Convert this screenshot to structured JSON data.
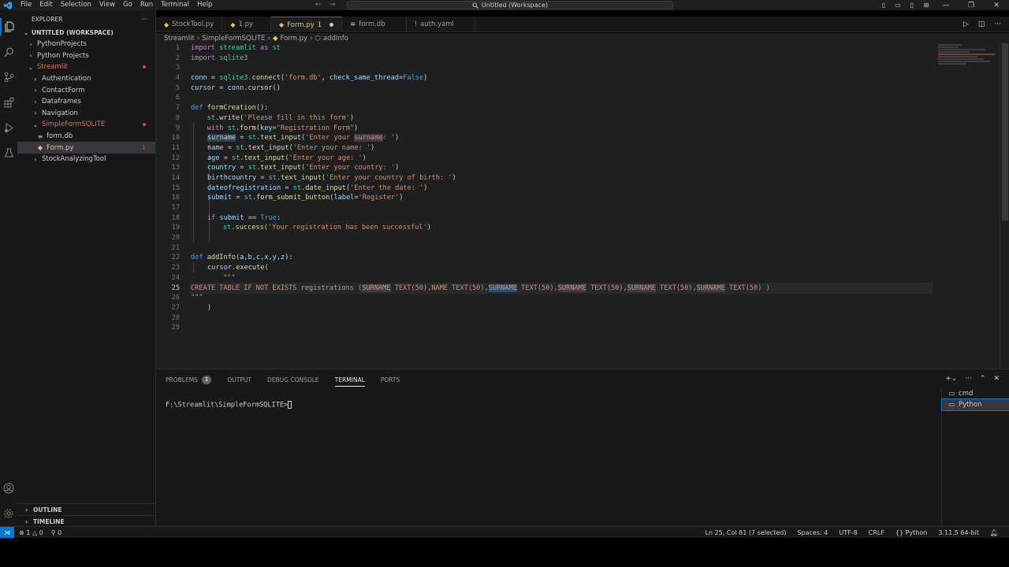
{
  "titlebar": {
    "menu": [
      "File",
      "Edit",
      "Selection",
      "View",
      "Go",
      "Run",
      "Terminal",
      "Help"
    ],
    "search_text": "Untitled (Workspace)"
  },
  "sidebar": {
    "header": "EXPLORER",
    "workspace": "UNTITLED (WORKSPACE)",
    "items": [
      {
        "label": "PythonProjects",
        "indent": 1,
        "chev": "›"
      },
      {
        "label": "Python Projects",
        "indent": 1,
        "chev": "›"
      },
      {
        "label": "Streamlit",
        "indent": 1,
        "chev": "⌄"
      },
      {
        "label": "Authentication",
        "indent": 2,
        "chev": "›"
      },
      {
        "label": "ContactForm",
        "indent": 2,
        "chev": "›"
      },
      {
        "label": "Dataframes",
        "indent": 2,
        "chev": "›"
      },
      {
        "label": "Navigation",
        "indent": 2,
        "chev": "›"
      },
      {
        "label": "SimpleFormSQLITE",
        "indent": 2,
        "chev": "⌄"
      },
      {
        "label": "form.db",
        "indent": 3,
        "chev": "≡"
      },
      {
        "label": "Form.py",
        "indent": 3,
        "chev": "◆",
        "badge": "1"
      },
      {
        "label": "StockAnalyzingTool",
        "indent": 2,
        "chev": "›"
      }
    ],
    "outline": "OUTLINE",
    "timeline": "TIMELINE"
  },
  "tabs": [
    {
      "label": "StockTool.py"
    },
    {
      "label": "1.py"
    },
    {
      "label": "Form.py",
      "count": "1"
    },
    {
      "label": "form.db"
    },
    {
      "label": "auth.yaml"
    }
  ],
  "breadcrumb": [
    "Streamlit",
    "SimpleFormSQLITE",
    "Form.py",
    "addInfo"
  ],
  "code": {
    "current_line": 25,
    "line_numbers": [
      "1",
      "2",
      "3",
      "4",
      "5",
      "6",
      "7",
      "8",
      "9",
      "10",
      "11",
      "12",
      "13",
      "14",
      "15",
      "16",
      "17",
      "18",
      "19",
      "20",
      "21",
      "22",
      "23",
      "24",
      "25",
      "26",
      "27",
      "28",
      "29"
    ],
    "lines": {
      "l1a": "import",
      "l1b": " streamlit ",
      "l1c": "as",
      "l1d": " st",
      "l2a": "import",
      "l2b": " sqlite3",
      "l4a": "conn",
      "l4b": " = ",
      "l4c": "sqlite3",
      "l4d": ".",
      "l4e": "connect",
      "l4f": "(",
      "l4g": "'form.db'",
      "l4h": ", ",
      "l4i": "check_same_thread",
      "l4j": "=",
      "l4k": "False",
      "l4l": ")",
      "l5a": "cursor",
      "l5b": " = ",
      "l5c": "conn",
      "l5d": ".",
      "l5e": "cursor",
      "l5f": "()",
      "l7a": "def",
      "l7b": " ",
      "l7c": "formCreation",
      "l7d": "():",
      "l8a": "    st",
      "l8b": ".",
      "l8c": "write",
      "l8d": "(",
      "l8e": "'Please fill in this form'",
      "l8f": ")",
      "l9a": "    with",
      "l9b": " st",
      "l9c": ".",
      "l9d": "form",
      "l9e": "(",
      "l9f": "key",
      "l9g": "=",
      "l9h": "\"Registration Form\"",
      "l9i": ")",
      "l10a": "surname",
      "l10b": " = ",
      "l10c": "st",
      "l10d": ".",
      "l10e": "text_input",
      "l10f": "(",
      "l10g": "'Enter your ",
      "l10h": "surname",
      "l10i": ": '",
      "l10j": ")",
      "l11a": "name",
      "l11b": " = ",
      "l11c": "st",
      "l11d": ".",
      "l11e": "text_input",
      "l11f": "(",
      "l11g": "'Enter your name: '",
      "l11h": ")",
      "l12a": "age",
      "l12b": " = ",
      "l12c": "st",
      "l12d": ".",
      "l12e": "text_input",
      "l12f": "(",
      "l12g": "'Enter your age: '",
      "l12h": ")",
      "l13a": "country",
      "l13b": " = ",
      "l13c": "st",
      "l13d": ".",
      "l13e": "text_input",
      "l13f": "(",
      "l13g": "'Enter your country: '",
      "l13h": ")",
      "l14a": "birthcountry",
      "l14b": " = ",
      "l14c": "st",
      "l14d": ".",
      "l14e": "text_input",
      "l14f": "(",
      "l14g": "'Enter your country of birth: '",
      "l14h": ")",
      "l15a": "dateofregistration",
      "l15b": " = ",
      "l15c": "st",
      "l15d": ".",
      "l15e": "date_input",
      "l15f": "(",
      "l15g": "'Enter the date: '",
      "l15h": ")",
      "l16a": "submit",
      "l16b": " = ",
      "l16c": "st",
      "l16d": ".",
      "l16e": "form_submit_button",
      "l16f": "(",
      "l16g": "label",
      "l16h": "=",
      "l16i": "'Register'",
      "l16j": ")",
      "l18a": "if",
      "l18b": " submit",
      "l18c": " == ",
      "l18d": "True",
      "l18e": ":",
      "l19a": "st",
      "l19b": ".",
      "l19c": "success",
      "l19d": "(",
      "l19e": "'Your registration has been successful'",
      "l19f": ")",
      "l22a": "def",
      "l22b": " ",
      "l22c": "addInfo",
      "l22d": "(",
      "l22e": "a",
      "l22f": ",",
      "l22g": "b",
      "l22h": ",",
      "l22i": "c",
      "l22j": ",",
      "l22k": "x",
      "l22l": ",",
      "l22m": "y",
      "l22n": ",",
      "l22o": "z",
      "l22p": "):",
      "l23a": "cursor",
      "l23b": ".",
      "l23c": "execute",
      "l23d": "(",
      "l24a": "\"\"\"",
      "l25a": "CREATE TABLE IF NOT EXISTS registrations (",
      "l25b": "SURNAME",
      "l25c": " TEXT(50),NAME TEXT(50),",
      "l25d": "SURNAME",
      "l25e": " TEXT(50),",
      "l25f": "SURNAME",
      "l25g": " TEXT(50),",
      "l25h": "SURNAME",
      "l25i": " TEXT(50),",
      "l25j": "SURNAME",
      "l25k": " TEXT(50) )",
      "l26a": "\"\"\"",
      "l27a": ")"
    }
  },
  "panel": {
    "tabs": [
      "PROBLEMS",
      "OUTPUT",
      "DEBUG CONSOLE",
      "TERMINAL",
      "PORTS"
    ],
    "problems_count": "1",
    "active_tab": "TERMINAL",
    "prompt": "F:\\Streamlit\\SimpleFormSQLITE>",
    "terminals": [
      "cmd",
      "Python"
    ]
  },
  "statusbar": {
    "errors": "1",
    "warnings": "0",
    "ports": "0",
    "position": "Ln 25, Col 81 (7 selected)",
    "spaces": "Spaces: 4",
    "encoding": "UTF-8",
    "eol": "CRLF",
    "language": "Python",
    "interpreter": "3.11.5 64-bit"
  },
  "colors": {
    "accent": "#0078d4",
    "error": "#c74e39",
    "modified": "#e2c08d"
  }
}
